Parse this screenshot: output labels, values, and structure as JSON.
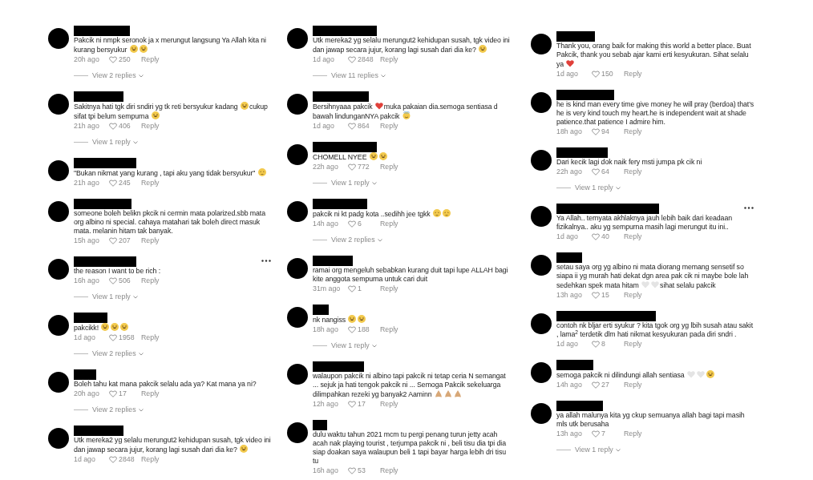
{
  "columns": [
    {
      "comments": [
        {
          "body": [
            {
              "kind": "text",
              "text": "Pakcik ni nmpk seronok ja x merungut langsung Ya Allah kita ni kurang bersyukur"
            },
            {
              "kind": "laugh-emoji"
            },
            {
              "kind": "laugh-emoji"
            }
          ],
          "time": "20h ago",
          "likes": "250",
          "reply": "Reply",
          "more": false,
          "view_replies": "View 2 replies"
        },
        {
          "body": [
            {
              "kind": "text",
              "text": "Sakitnya hati tgk diri sndiri yg tk reti bersyukur kadang"
            },
            {
              "kind": "laugh-emoji"
            },
            {
              "kind": "text",
              "text": "cukup sifat tpi belum sempurna"
            },
            {
              "kind": "laugh-emoji"
            }
          ],
          "time": "21h ago",
          "likes": "406",
          "reply": "Reply",
          "more": false,
          "view_replies": "View 1 reply"
        },
        {
          "body": [
            {
              "kind": "text",
              "text": "\"Bukan nikmat yang kurang , tapi aku yang tidak bersyukur\""
            },
            {
              "kind": "sad-emoji"
            }
          ],
          "time": "21h ago",
          "likes": "245",
          "reply": "Reply",
          "more": false
        },
        {
          "body": [
            {
              "kind": "text",
              "text": "someone boleh belikn pkcik ni cermin mata polarized.sbb mata org albino ni special. cahaya matahari tak boleh direct masuk mata. melanin hitam tak banyak."
            }
          ],
          "time": "15h ago",
          "likes": "207",
          "reply": "Reply",
          "more": false
        },
        {
          "body": [
            {
              "kind": "text",
              "text": "the reason I want to be rich :"
            }
          ],
          "time": "16h ago",
          "likes": "506",
          "reply": "Reply",
          "more": true,
          "view_replies": "View 1 reply"
        },
        {
          "body": [
            {
              "kind": "text",
              "text": "pakcikk!"
            },
            {
              "kind": "laugh-emoji"
            },
            {
              "kind": "laugh-emoji"
            },
            {
              "kind": "laugh-emoji"
            }
          ],
          "time": "1d ago",
          "likes": "1958",
          "reply": "Reply",
          "more": false,
          "view_replies": "View 2 replies"
        },
        {
          "body": [
            {
              "kind": "text",
              "text": "Boleh tahu kat mana pakcik selalu ada ya? Kat mana ya ni?"
            }
          ],
          "time": "20h ago",
          "likes": "17",
          "reply": "Reply",
          "more": false,
          "view_replies": "View 2 replies"
        },
        {
          "body": [
            {
              "kind": "text",
              "text": "Utk mereka2 yg selalu merungut2 kehidupan susah, tgk video ini dan jawap secara jujur, korang lagi susah dari dia ke?"
            },
            {
              "kind": "laugh-emoji"
            }
          ],
          "time": "1d ago",
          "likes": "2848",
          "reply": "Reply",
          "more": false
        }
      ]
    },
    {
      "comments": [
        {
          "body": [
            {
              "kind": "text",
              "text": "Utk mereka2 yg selalu merungut2 kehidupan susah, tgk video ini dan jawap secara jujur, korang lagi susah dari dia ke?"
            },
            {
              "kind": "laugh-emoji"
            }
          ],
          "time": "1d ago",
          "likes": "2848",
          "reply": "Reply",
          "more": false,
          "view_replies": "View 11 replies"
        },
        {
          "body": [
            {
              "kind": "text",
              "text": "Bersihnyaaa pakcik"
            },
            {
              "kind": "heart-emoji"
            },
            {
              "kind": "text",
              "text": "muka pakaian dia.semoga sentiasa d bawah lindunganNYA pakcik"
            },
            {
              "kind": "halo-emoji"
            }
          ],
          "time": "1d ago",
          "likes": "864",
          "reply": "Reply",
          "more": false
        },
        {
          "body": [
            {
              "kind": "text",
              "text": "CHOMELL NYEE"
            },
            {
              "kind": "laugh-emoji"
            },
            {
              "kind": "laugh-emoji"
            }
          ],
          "time": "22h ago",
          "likes": "772",
          "reply": "Reply",
          "more": false,
          "view_replies": "View 1 reply"
        },
        {
          "body": [
            {
              "kind": "text",
              "text": "pakcik ni kt padg kota ..sedihh jee tgkk"
            },
            {
              "kind": "sad-emoji"
            },
            {
              "kind": "sad-emoji"
            }
          ],
          "time": "14h ago",
          "likes": "6",
          "reply": "Reply",
          "more": false,
          "view_replies": "View 2 replies"
        },
        {
          "body": [
            {
              "kind": "text",
              "text": "ramai org mengeluh sebabkan kurang duit tapi lupe ALLAH bagi kite anggota sempurna untuk cari duit"
            }
          ],
          "time": "31m ago",
          "likes": "1",
          "reply": "Reply",
          "more": false
        },
        {
          "body": [
            {
              "kind": "text",
              "text": "nk nangiss"
            },
            {
              "kind": "laugh-emoji"
            },
            {
              "kind": "laugh-emoji"
            }
          ],
          "time": "18h ago",
          "likes": "188",
          "reply": "Reply",
          "more": false,
          "view_replies": "View 1 reply"
        },
        {
          "body": [
            {
              "kind": "text",
              "text": "walaupon pakcik ni albino tapi pakcik ni tetap ceria N semangat ... sejuk ja hati tengok pakcik ni ... Semoga Pakcik sekeluarga dilimpahkan rezeki yg banyak2 Aaminn"
            },
            {
              "kind": "pray-emoji"
            },
            {
              "kind": "pray-emoji"
            },
            {
              "kind": "pray-emoji"
            }
          ],
          "time": "12h ago",
          "likes": "17",
          "reply": "Reply",
          "more": false
        },
        {
          "body": [
            {
              "kind": "text",
              "text": "dulu waktu tahun 2021 mcm tu pergi penang turun jetty acah acah nak playing tourist , terjumpa pakcik ni , beli tisu dia tpi dia siap doakan saya walaupun beli 1 tapi bayar harga lebih dri tisu tu"
            }
          ],
          "time": "16h ago",
          "likes": "53",
          "reply": "Reply",
          "more": false
        }
      ]
    },
    {
      "comments": [
        {
          "body": [
            {
              "kind": "text",
              "text": "Thank you, orang baik for making this world a better place. Buat Pakcik, thank you sebab ajar kami erti kesyukuran. Sihat selalu ya"
            },
            {
              "kind": "heart-emoji"
            }
          ],
          "time": "1d ago",
          "likes": "150",
          "reply": "Reply",
          "more": false
        },
        {
          "body": [
            {
              "kind": "text",
              "text": "he is kind man every time give money he will pray (berdoa) that's he is very kind touch my heart.he is independent wait at shade patience.that patience I admire him."
            }
          ],
          "time": "18h ago",
          "likes": "94",
          "reply": "Reply",
          "more": false
        },
        {
          "body": [
            {
              "kind": "text",
              "text": "Dari kecik lagi dok naik fery msti jumpa pk cik ni"
            }
          ],
          "time": "22h ago",
          "likes": "64",
          "reply": "Reply",
          "more": false,
          "view_replies": "View 1 reply"
        },
        {
          "body": [
            {
              "kind": "text",
              "text": "Ya Allah.. ternyata akhlaknya jauh lebih baik dari keadaan fizikalnya.. aku yg sempurna masih lagi merungut itu ini.."
            }
          ],
          "time": "1d ago",
          "likes": "40",
          "reply": "Reply",
          "more": true
        },
        {
          "body": [
            {
              "kind": "text",
              "text": "setau saya org yg albino ni mata diorang memang sensetif so siapa ii yg murah hati dekat dgn area pak cik ni maybe bole lah sedehkan spek mata hitam"
            },
            {
              "kind": "white-heart-emoji"
            },
            {
              "kind": "white-heart-emoji"
            },
            {
              "kind": "text",
              "text": "sihat selalu pakcik"
            }
          ],
          "time": "13h ago",
          "likes": "15",
          "reply": "Reply",
          "more": false
        },
        {
          "body": [
            {
              "kind": "text",
              "text": "contoh nk bljar erti syukur ? kita tgok org yg lbih susah atau sakit , lama$^{2}$ terdetik dlm hati nikmat kesyukuran pada diri sndri ."
            }
          ],
          "time": "1d ago",
          "likes": "8",
          "reply": "Reply",
          "more": false
        },
        {
          "body": [
            {
              "kind": "text",
              "text": "semoga pakcik ni dilindungi allah sentiasa"
            },
            {
              "kind": "white-heart-emoji"
            },
            {
              "kind": "white-heart-emoji"
            },
            {
              "kind": "laugh-emoji"
            }
          ],
          "time": "14h ago",
          "likes": "27",
          "reply": "Reply",
          "more": false
        },
        {
          "body": [
            {
              "kind": "text",
              "text": "ya allah malunya kita yg ckup semuanya allah bagi tapi masih mls utk berusaha"
            }
          ],
          "time": "13h ago",
          "likes": "7",
          "reply": "Reply",
          "more": false,
          "view_replies": "View 1 reply"
        }
      ]
    }
  ]
}
